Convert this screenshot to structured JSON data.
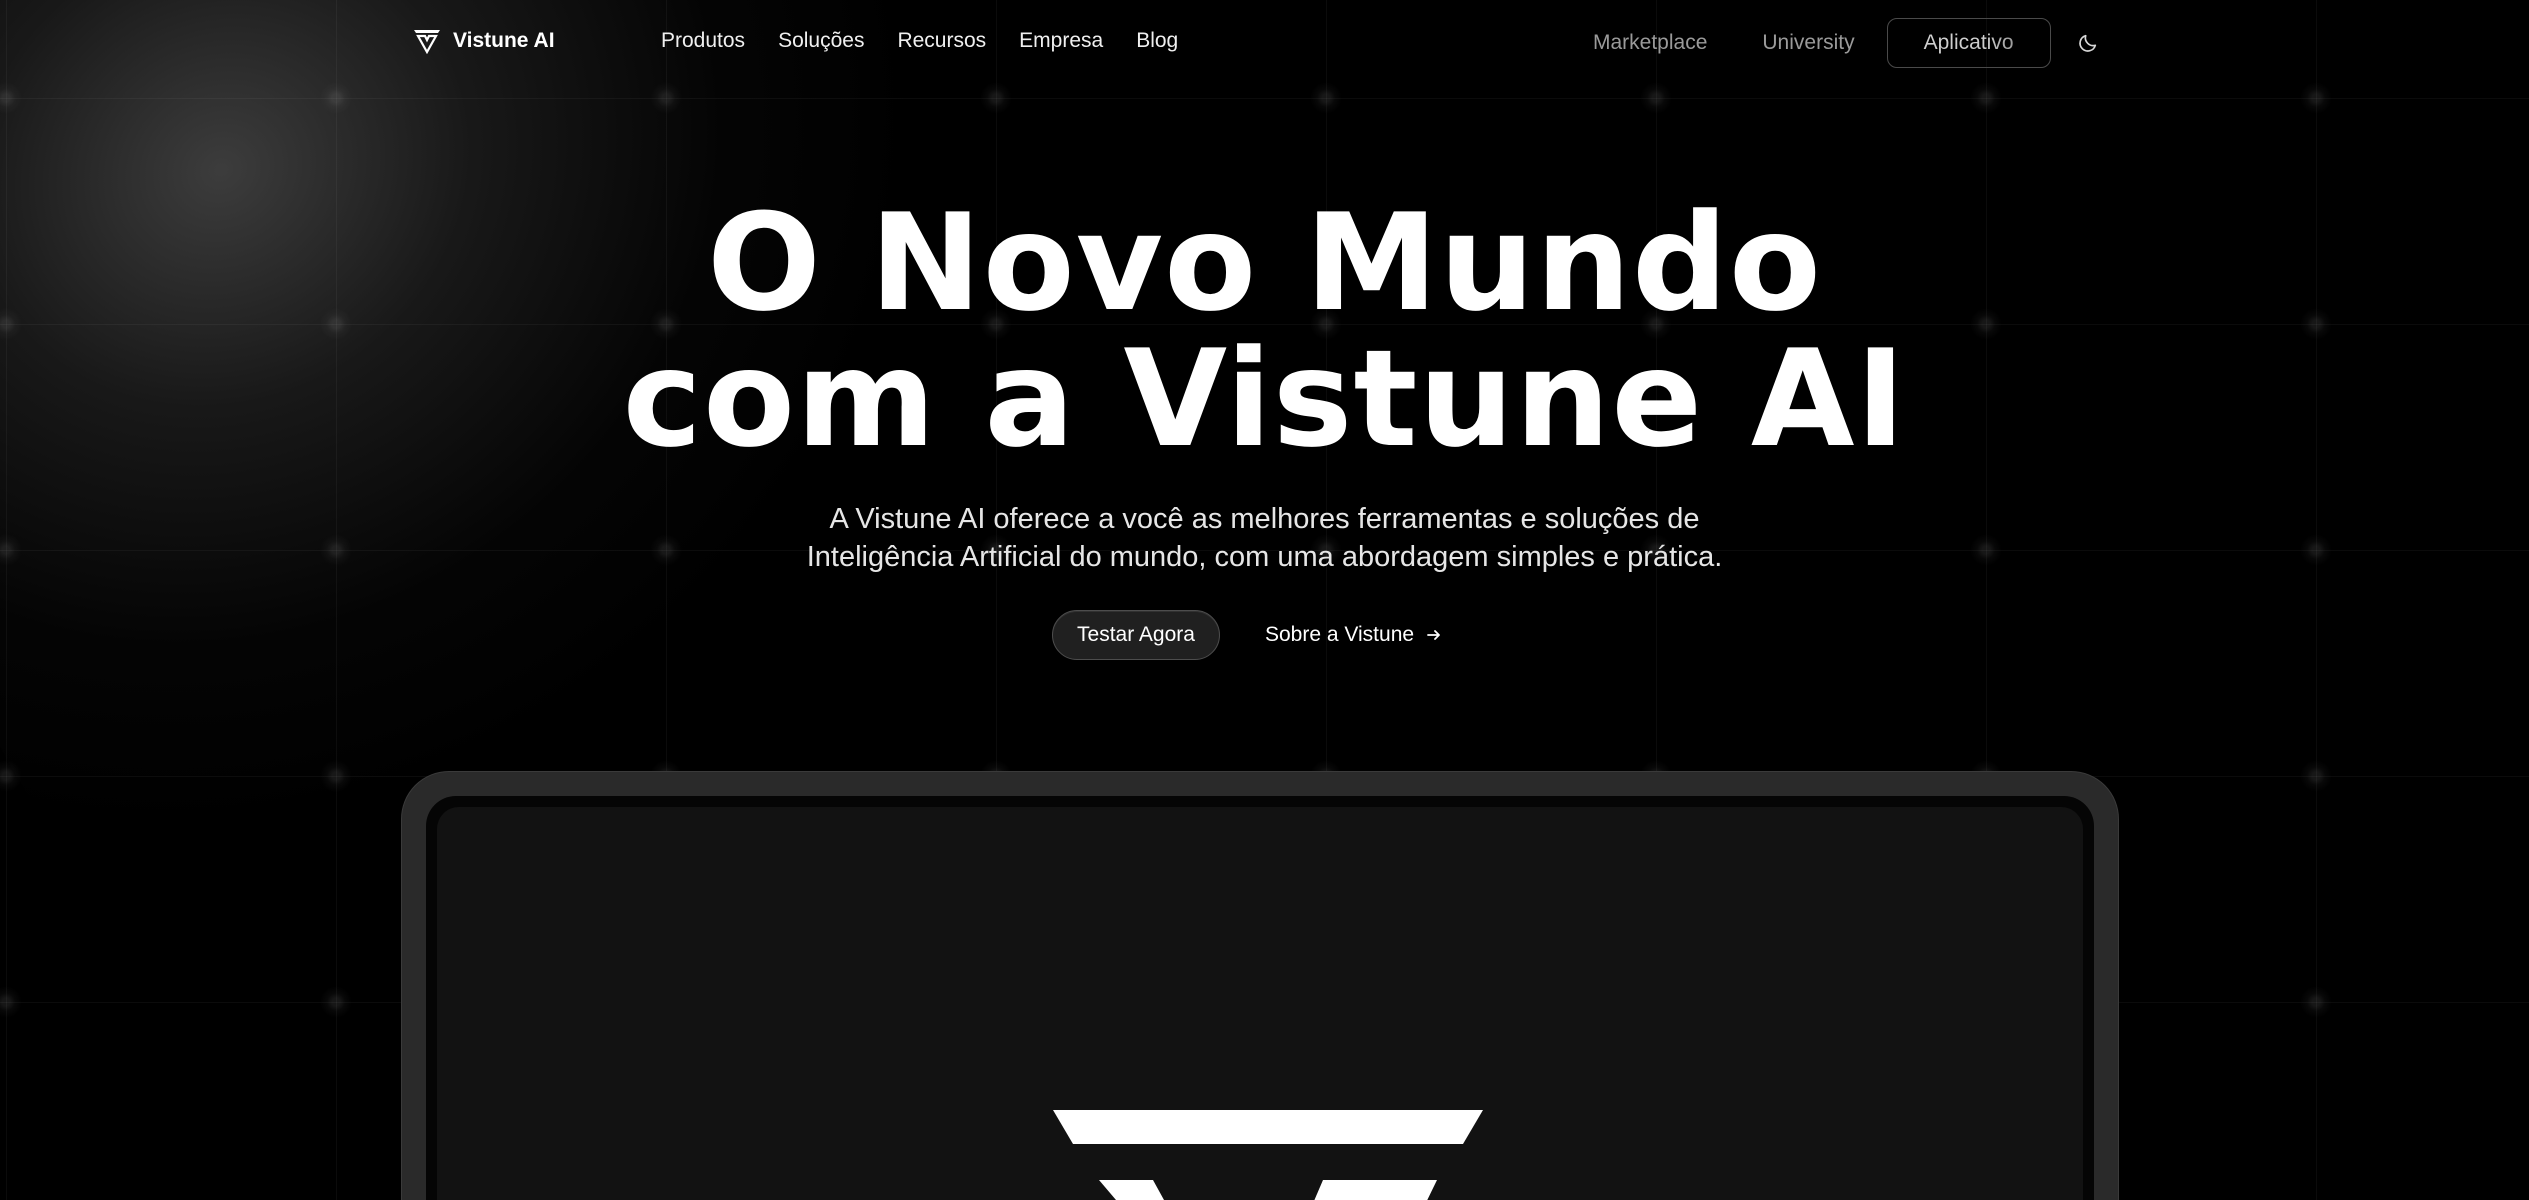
{
  "navbar": {
    "brand_name": "Vistune AI",
    "brand_icon": "vistune-logo-icon",
    "links": [
      {
        "label": "Produtos"
      },
      {
        "label": "Soluções"
      },
      {
        "label": "Recursos"
      },
      {
        "label": "Empresa"
      },
      {
        "label": "Blog"
      }
    ],
    "marketplace_label": "Marketplace",
    "university_label": "University",
    "app_button_label": "Aplicativo",
    "theme_toggle_icon": "moon-icon"
  },
  "hero": {
    "title_line1": "O Novo Mundo",
    "title_line2": "com a Vistune AI",
    "subtitle_line1": "A Vistune AI oferece a você as melhores ferramentas e soluções de",
    "subtitle_line2": "Inteligência Artificial do mundo, com uma abordagem simples e prática.",
    "primary_cta_label": "Testar Agora",
    "secondary_cta_label": "Sobre a Vistune",
    "secondary_cta_icon": "arrow-right-icon"
  },
  "preview": {
    "screen_icon": "vistune-logo-large-icon"
  },
  "colors": {
    "background": "#000000",
    "text": "#ffffff",
    "muted_text": "#9a9a9a",
    "device_frame": "#2a2a2a",
    "screen": "#121212"
  }
}
